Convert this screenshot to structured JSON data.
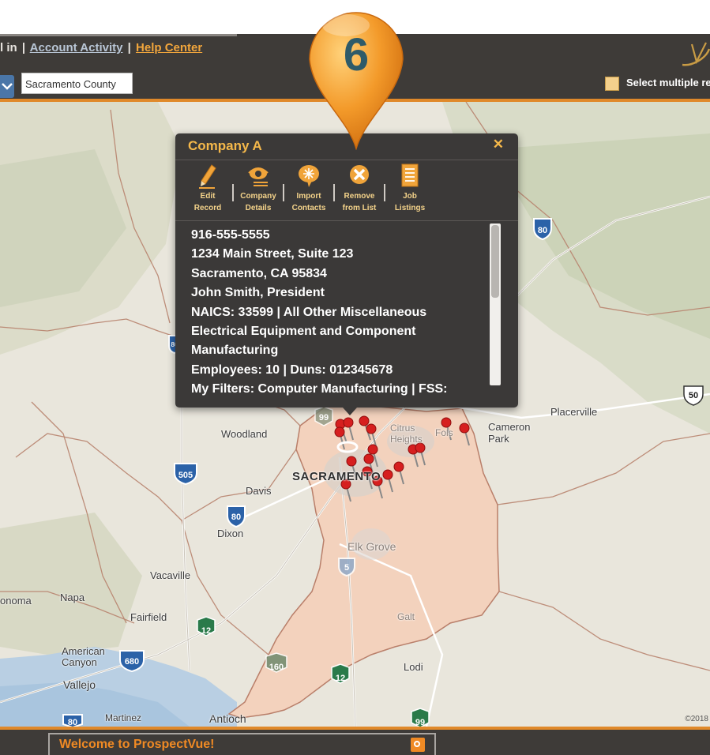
{
  "header": {
    "links": {
      "signin_fragment": "l in",
      "account_activity": "Account Activity",
      "help_center": "Help Center"
    },
    "county_value": "Sacramento County",
    "multi_region_label": "Select multiple reg"
  },
  "badge": {
    "number": "6"
  },
  "map": {
    "labels": {
      "woodland": "Woodland",
      "sacramento": "SACRAMENTO",
      "davis": "Davis",
      "dixon": "Dixon",
      "vacaville": "Vacaville",
      "napa": "Napa",
      "sonoma": "onoma",
      "fairfield": "Fairfield",
      "american_canyon": "American\nCanyon",
      "vallejo": "Vallejo",
      "martinez": "Martinez",
      "antioch": "Antioch",
      "lodi": "Lodi",
      "galt": "Galt",
      "elk_grove": "Elk Grove",
      "citrus_heights": "Citrus\nHeights",
      "folsom": "Fols",
      "placerville": "Placerville",
      "cameron_park": "Cameron\nPark",
      "copyright": "©2018"
    },
    "highways": [
      "80",
      "50",
      "505",
      "80",
      "5",
      "12",
      "680",
      "160",
      "12",
      "99",
      "99",
      "80",
      "80"
    ]
  },
  "popup": {
    "title": "Company A",
    "close_symbol": "✕",
    "tools": [
      {
        "line1": "Edit",
        "line2": "Record",
        "icon": "pencil-icon"
      },
      {
        "line1": "Company",
        "line2": "Details",
        "icon": "eye-icon"
      },
      {
        "line1": "Import",
        "line2": "Contacts",
        "icon": "speech-bubble-icon"
      },
      {
        "line1": "Remove",
        "line2": "from List",
        "icon": "remove-x-icon"
      },
      {
        "line1": "Job",
        "line2": "Listings",
        "icon": "list-icon"
      }
    ],
    "info": {
      "phone": "916-555-5555",
      "address1": "1234 Main Street, Suite 123",
      "address2": "Sacramento, CA 95834",
      "contact": "John Smith, President",
      "naics1": "NAICS: 33599 | All Other Miscellaneous",
      "naics2": "Electrical Equipment and Component",
      "naics3": "Manufacturing",
      "employees": "Employees: 10 | Duns: 012345678",
      "filters": "My Filters: Computer Manufacturing | FSS:"
    },
    "scroll_position": 0
  },
  "footer": {
    "welcome": "Welcome to ProspectVue!"
  },
  "colors": {
    "accent_orange": "#e0892a",
    "header_bg": "#3e3b38",
    "popup_title": "#f5b84a",
    "county_fill": "#f3d2bd",
    "pin_red": "#d61f1f"
  }
}
